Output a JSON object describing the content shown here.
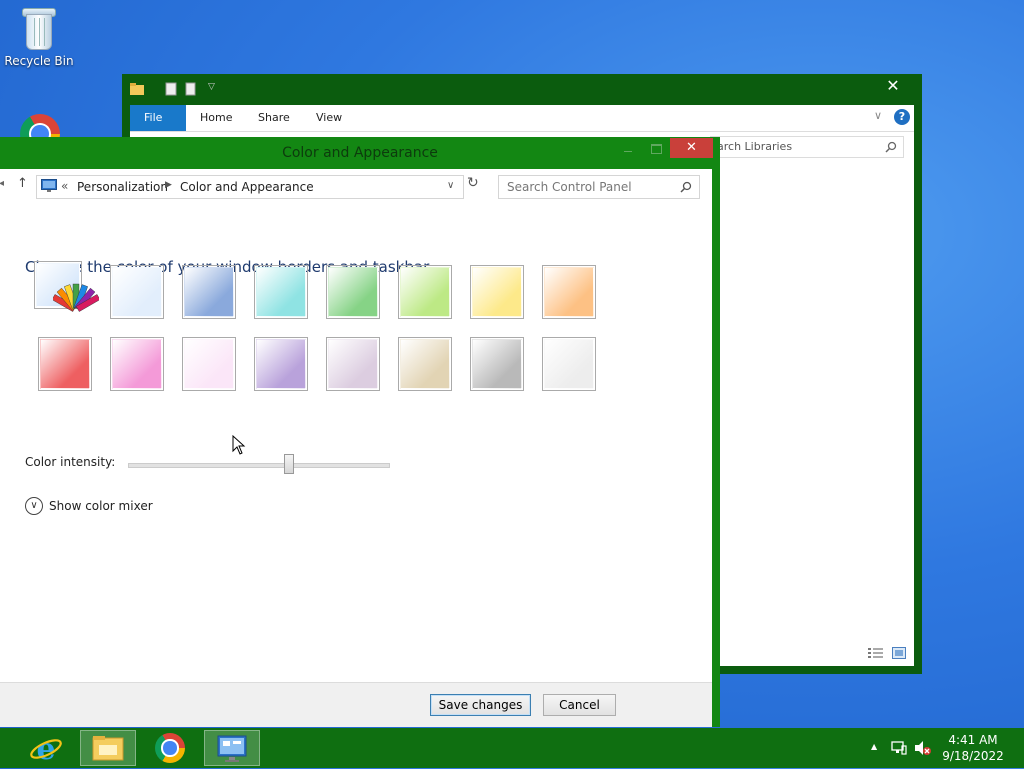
{
  "desktop": {
    "recycle_bin_label": "Recycle Bin"
  },
  "explorer": {
    "tabs": [
      "File",
      "Home",
      "Share",
      "View"
    ],
    "search_placeholder": "arch Libraries",
    "close_glyph": "✕"
  },
  "window": {
    "title": "Color and Appearance",
    "breadcrumb": {
      "chevrons": "«",
      "items": [
        "Personalization",
        "Color and Appearance"
      ]
    },
    "search_placeholder": "Search Control Panel",
    "heading": "Change the color of your window borders and taskbar",
    "swatches_row1": [
      {
        "name": "automatic",
        "color": "#d8e8fb"
      },
      {
        "name": "sky",
        "color": "#e2eefc"
      },
      {
        "name": "twilight",
        "color": "#8aa9dc"
      },
      {
        "name": "sea-foam",
        "color": "#8fe3e3"
      },
      {
        "name": "leaf",
        "color": "#86d386"
      },
      {
        "name": "lime",
        "color": "#bde985"
      },
      {
        "name": "sun",
        "color": "#fde98a"
      },
      {
        "name": "pumpkin",
        "color": "#fdc184"
      }
    ],
    "swatches_row2": [
      {
        "name": "blush",
        "color": "#ee5f61"
      },
      {
        "name": "bubblegum",
        "color": "#f49ad8"
      },
      {
        "name": "lavender",
        "color": "#fbe6f8"
      },
      {
        "name": "taupe",
        "color": "#b9a2db"
      },
      {
        "name": "chocolate",
        "color": "#dccde0"
      },
      {
        "name": "slate",
        "color": "#e2d4b4"
      },
      {
        "name": "frost",
        "color": "#b9b9b9"
      },
      {
        "name": "white",
        "color": "#ededed"
      }
    ],
    "color_intensity_label": "Color intensity:",
    "color_intensity_value": 0.62,
    "show_mixer_label": "Show color mixer",
    "save_label": "Save changes",
    "cancel_label": "Cancel",
    "close_glyph": "✕"
  },
  "taskbar": {
    "time": "4:41 AM",
    "date": "9/18/2022",
    "tray_arrow": "▲"
  },
  "colors": {
    "window_frame": "#138713",
    "explorer_frame": "#0b5c0e",
    "taskbar": "#0f6f11",
    "accent_file_tab": "#1979ca",
    "close_button": "#c9403a"
  }
}
